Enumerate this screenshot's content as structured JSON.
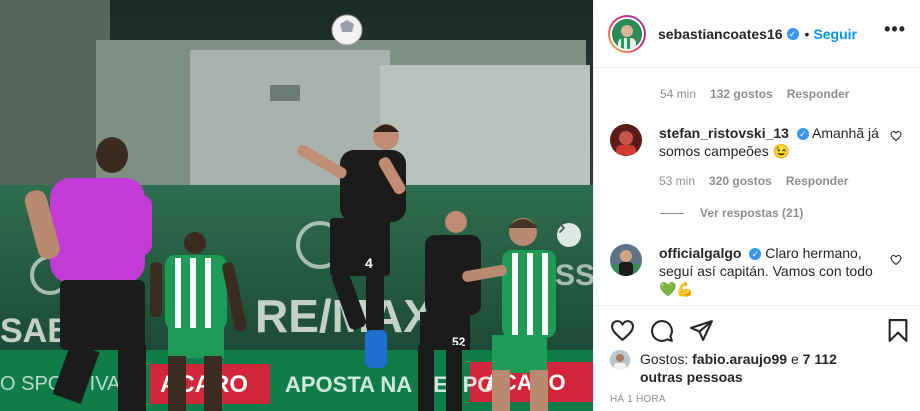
{
  "post": {
    "username": "sebastiancoates16",
    "follow_label": "Seguir",
    "separator": "•",
    "more_label": "•••"
  },
  "comments": [
    {
      "time": "54 min",
      "likes": "132 gostos",
      "reply": "Responder"
    },
    {
      "username": "stefan_ristovski_13",
      "text": "Amanhã já somos campeões",
      "emoji": "😉",
      "time": "53 min",
      "likes": "320 gostos",
      "reply": "Responder",
      "view_replies": "Ver respostas (21)"
    },
    {
      "username": "officialgalgo",
      "text": "Claro hermano, seguí así capitán. Vamos con todo",
      "emoji": "💚💪"
    }
  ],
  "likes_summary": {
    "prefix": "Gostos:",
    "first_user": "fabio.araujo99",
    "joiner": "e",
    "others": "7 112 outras pessoas"
  },
  "time_ago": "HÁ 1 HORA",
  "colors": {
    "link_blue": "#0095f6",
    "verified_blue": "#3897f0",
    "secondary_text": "#8e8e8e",
    "ad_board_red": "#d3263b",
    "sporting_green": "#0a7a43"
  },
  "icons": [
    "verified-icon",
    "heart-icon",
    "comment-icon",
    "share-icon",
    "bookmark-icon",
    "chevron-right-icon",
    "more-icon"
  ]
}
